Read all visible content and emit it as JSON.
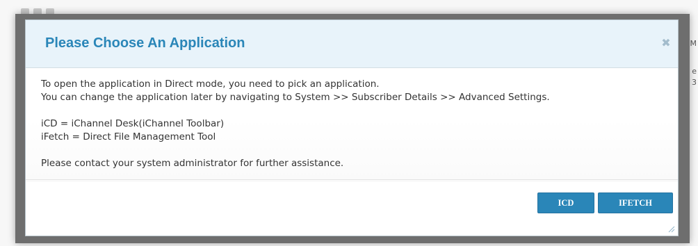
{
  "background": {
    "edge_texts": [
      "M",
      "e",
      "3"
    ]
  },
  "dialog": {
    "title": "Please Choose An Application",
    "close_icon": "close-icon",
    "body": {
      "line1": "To open the application in Direct mode, you need to pick an application.",
      "line2": "You can change the application later by navigating to System >> Subscriber Details >> Advanced Settings.",
      "line3": "iCD = iChannel Desk(iChannel Toolbar)",
      "line4": "iFetch = Direct File Management Tool",
      "line5": "Please contact your system administrator for further assistance."
    },
    "buttons": {
      "icd_label": "ICD",
      "ifetch_label": "IFETCH"
    }
  },
  "colors": {
    "accent": "#2a86b8",
    "header_bg": "#e8f3fa"
  }
}
